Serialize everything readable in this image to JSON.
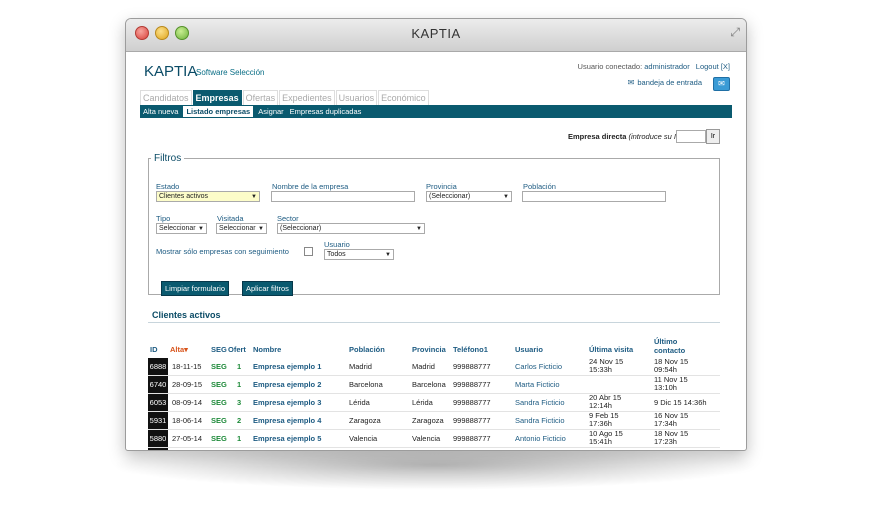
{
  "window": {
    "title": "KAPTIA"
  },
  "header": {
    "logo": "KAPTIA",
    "subtitle": "Software Selección",
    "user_prefix": "Usuario conectado:",
    "user_name": "administrador",
    "logout": "Logout [X]",
    "inbox": "bandeja de entrada"
  },
  "tabs": [
    "Candidatos",
    "Empresas",
    "Ofertas",
    "Expedientes",
    "Usuarios",
    "Económico"
  ],
  "active_tab": "Empresas",
  "subnav": [
    "Alta nueva",
    "Listado empresas",
    "Asignar",
    "Empresas duplicadas"
  ],
  "active_subnav": "Listado empresas",
  "direct": {
    "label": "Empresa directa",
    "hint": "(introduce su ID):",
    "go": "Ir"
  },
  "filters": {
    "legend": "Filtros",
    "estado_label": "Estado",
    "estado_value": "Clientes activos",
    "nombre_label": "Nombre de la empresa",
    "provincia_label": "Provincia",
    "provincia_value": "(Seleccionar)",
    "poblacion_label": "Población",
    "tipo_label": "Tipo",
    "tipo_value": "Seleccionar",
    "visitada_label": "Visitada",
    "visitada_value": "Seleccionar",
    "sector_label": "Sector",
    "sector_value": "(Seleccionar)",
    "seguimiento_label": "Mostrar sólo empresas con seguimiento",
    "usuario_label": "Usuario",
    "usuario_value": "Todos",
    "clear_button": "Limpiar formulario",
    "apply_button": "Aplicar filtros"
  },
  "results": {
    "title": "Clientes activos",
    "headers": {
      "id": "ID",
      "alta": "Alta",
      "seg": "SEG",
      "ofert": "Ofert",
      "nombre": "Nombre",
      "poblacion": "Población",
      "provincia": "Provincia",
      "telefono": "Teléfono1",
      "usuario": "Usuario",
      "ultima_visita": "Última visita",
      "ultimo_contacto_1": "Último",
      "ultimo_contacto_2": "contacto"
    },
    "rows": [
      {
        "id": "6888",
        "alta": "18-11-15",
        "seg": "SEG",
        "ofert": "1",
        "nombre": "Empresa ejemplo 1",
        "poblacion": "Madrid",
        "provincia": "Madrid",
        "telefono": "999888777",
        "usuario": "Carlos Ficticio",
        "visita_1": "24 Nov 15",
        "visita_2": "15:33h",
        "contacto_1": "18 Nov 15",
        "contacto_2": "09:54h"
      },
      {
        "id": "6740",
        "alta": "28-09-15",
        "seg": "SEG",
        "ofert": "1",
        "nombre": "Empresa ejemplo 2",
        "poblacion": "Barcelona",
        "provincia": "Barcelona",
        "telefono": "999888777",
        "usuario": "Marta Ficticio",
        "visita_1": "",
        "visita_2": "",
        "contacto_1": "11 Nov 15",
        "contacto_2": "13:10h"
      },
      {
        "id": "6053",
        "alta": "08-09-14",
        "seg": "SEG",
        "ofert": "3",
        "nombre": "Empresa ejemplo 3",
        "poblacion": "Lérida",
        "provincia": "Lérida",
        "telefono": "999888777",
        "usuario": "Sandra Ficticio",
        "visita_1": "20 Abr 15",
        "visita_2": "12:14h",
        "contacto_1": "9 Dic 15 14:36h",
        "contacto_2": ""
      },
      {
        "id": "5931",
        "alta": "18-06-14",
        "seg": "SEG",
        "ofert": "2",
        "nombre": "Empresa ejemplo 4",
        "poblacion": "Zaragoza",
        "provincia": "Zaragoza",
        "telefono": "999888777",
        "usuario": "Sandra Ficticio",
        "visita_1": "9 Feb 15",
        "visita_2": "17:36h",
        "contacto_1": "16 Nov 15",
        "contacto_2": "17:34h"
      },
      {
        "id": "5880",
        "alta": "27-05-14",
        "seg": "SEG",
        "ofert": "1",
        "nombre": "Empresa ejemplo 5",
        "poblacion": "Valencia",
        "provincia": "Valencia",
        "telefono": "999888777",
        "usuario": "Antonio Ficticio",
        "visita_1": "10 Ago 15",
        "visita_2": "15:41h",
        "contacto_1": "18 Nov 15",
        "contacto_2": "17:23h"
      },
      {
        "id": "",
        "alta": "",
        "seg": "",
        "ofert": "",
        "nombre": "",
        "poblacion": "",
        "provincia": "",
        "telefono": "",
        "usuario": "",
        "visita_1": "",
        "visita_2": "",
        "contacto_1": "",
        "contacto_2": ""
      }
    ]
  }
}
